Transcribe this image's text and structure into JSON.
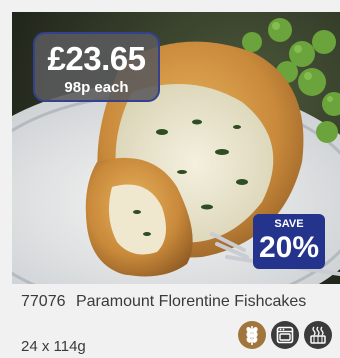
{
  "product": {
    "code": "77076",
    "name": "Paramount Florentine Fishcakes",
    "pack_size": "24 x 114g"
  },
  "price": {
    "main": "£23.65",
    "per_unit": "98p each"
  },
  "promo": {
    "label": "SAVE",
    "value": "20%"
  },
  "icons": [
    {
      "name": "vegetarian-wheat-icon",
      "color": "#a0763c"
    },
    {
      "name": "oven-icon",
      "color": "#3b3b3b"
    },
    {
      "name": "fryer-icon",
      "color": "#3b3b3b"
    }
  ],
  "colors": {
    "price_badge_border": "#33418f",
    "promo_badge": "#24348c",
    "text": "#3a3a3a"
  }
}
